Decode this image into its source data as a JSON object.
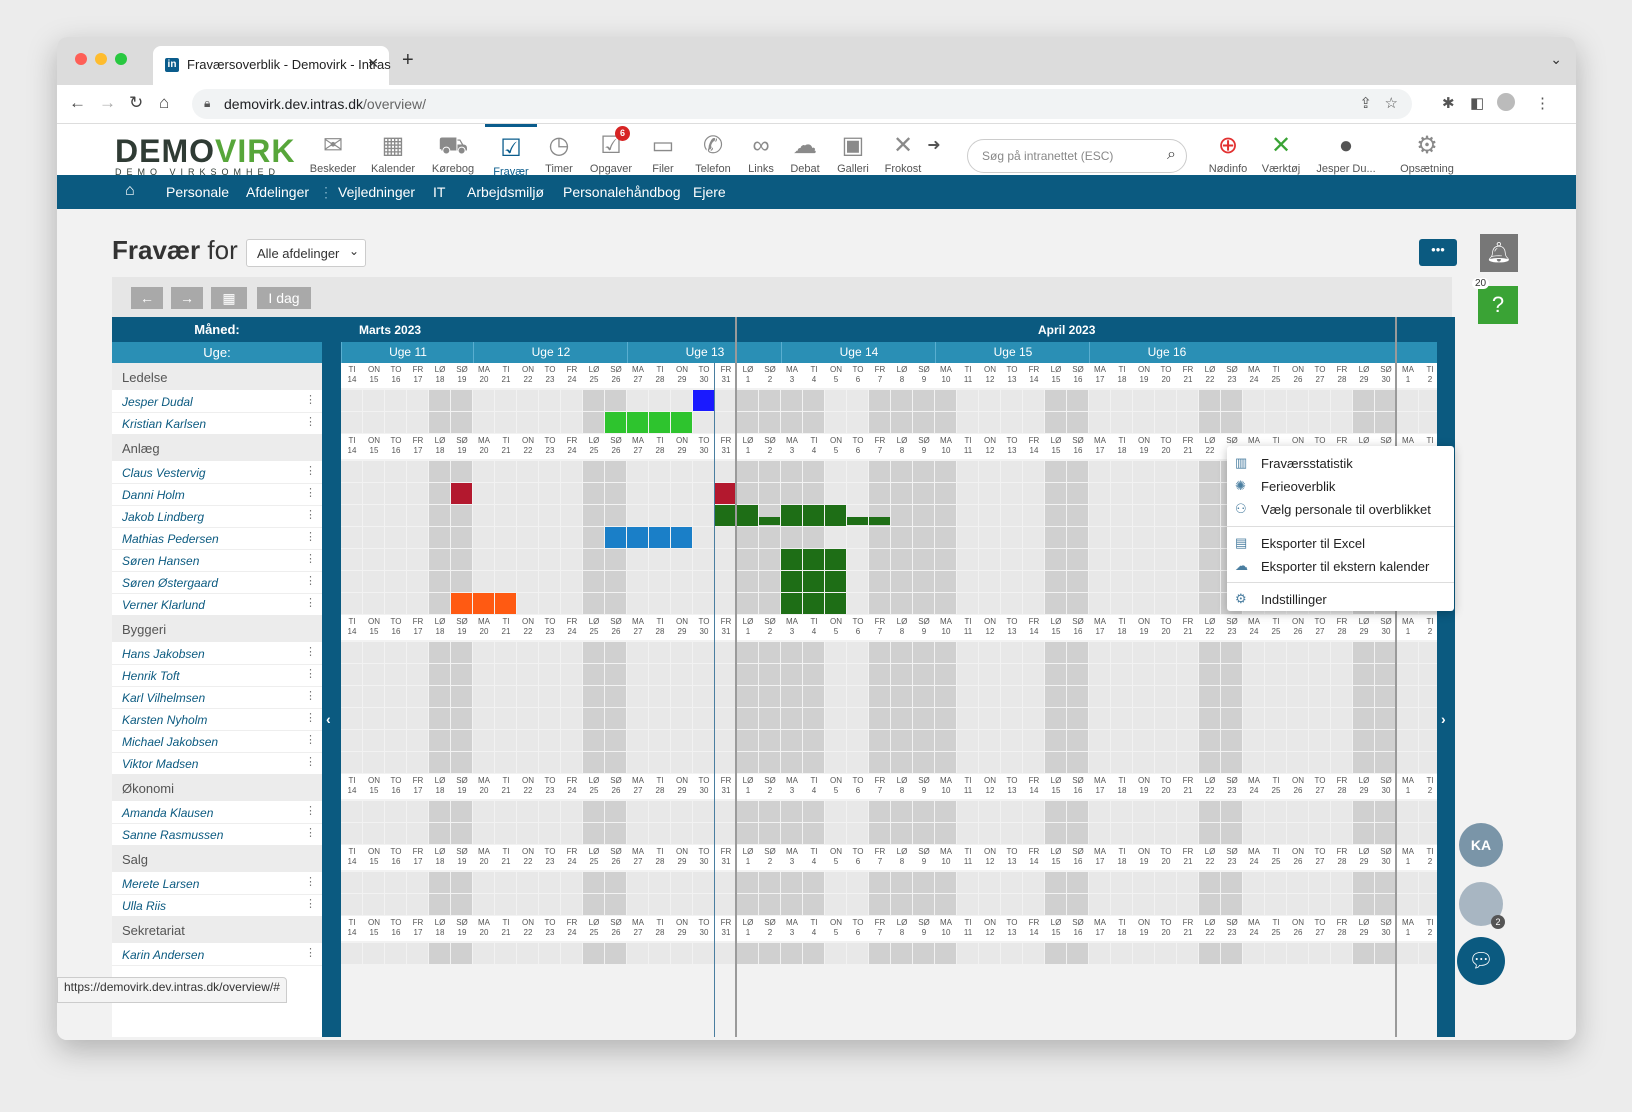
{
  "browser": {
    "tab_title": "Fraværsoverblik - Demovirk - Intras",
    "url_host": "demovirk.dev.intras.dk",
    "url_path": "/overview/",
    "status_url": "https://demovirk.dev.intras.dk/overview/#"
  },
  "logo": {
    "big_a": "DEMO",
    "big_b": "VIRK",
    "small": "DEMO VIRKSOMHED"
  },
  "apps": [
    {
      "label": "Beskeder",
      "icon": "✉"
    },
    {
      "label": "Kalender",
      "icon": "▦"
    },
    {
      "label": "Kørebog",
      "icon": "⛟"
    },
    {
      "label": "Fravær",
      "icon": "☑"
    },
    {
      "label": "Timer",
      "icon": "◷"
    },
    {
      "label": "Opgaver",
      "icon": "☑",
      "badge": "6"
    },
    {
      "label": "Filer",
      "icon": "▭"
    },
    {
      "label": "Telefon",
      "icon": "✆"
    },
    {
      "label": "Links",
      "icon": "∞"
    },
    {
      "label": "Debat",
      "icon": "☁"
    },
    {
      "label": "Galleri",
      "icon": "▣"
    },
    {
      "label": "Frokost",
      "icon": "✕"
    }
  ],
  "search": {
    "placeholder": "Søg på intranettet (ESC)"
  },
  "right_apps": [
    {
      "label": "Nødinfo",
      "icon": "⊕"
    },
    {
      "label": "Værktøj",
      "icon": "✕"
    },
    {
      "label": "Jesper Du...",
      "icon": "●"
    },
    {
      "label": "Opsætning",
      "icon": "⚙"
    }
  ],
  "nav": [
    "Personale",
    "Afdelinger",
    "Vejledninger",
    "IT",
    "Arbejdsmiljø",
    "Personalehåndbog",
    "Ejere"
  ],
  "page": {
    "title_bold": "Fravær",
    "title_rest": " for",
    "dept_select": "Alle afdelinger",
    "more": "•••",
    "help_badge": "20"
  },
  "toolbar": {
    "prev": "←",
    "next": "→",
    "cal": "▦",
    "today": "I dag"
  },
  "grid": {
    "month_label": "Måned:",
    "week_label": "Uge:",
    "months": [
      "Marts 2023",
      "April 2023"
    ],
    "weeks": [
      "Uge 11",
      "Uge 12",
      "Uge 13",
      "Uge 14",
      "Uge 15",
      "Uge 16"
    ],
    "day_abbr": [
      "TI",
      "ON",
      "TO",
      "FR",
      "LØ",
      "SØ",
      "MA",
      "TI",
      "ON",
      "TO",
      "FR",
      "LØ",
      "SØ",
      "MA",
      "TI",
      "ON",
      "TO",
      "FR",
      "LØ",
      "SØ",
      "MA",
      "TI",
      "ON",
      "TO",
      "FR",
      "LØ",
      "SØ",
      "MA",
      "TI",
      "ON",
      "TO",
      "FR",
      "LØ",
      "SØ",
      "MA",
      "TI",
      "ON",
      "TO",
      "FR",
      "LØ",
      "SØ",
      "MA",
      "TI",
      "ON",
      "TO",
      "FR",
      "LØ",
      "SØ",
      "MA",
      "TI"
    ],
    "day_num": [
      "14",
      "15",
      "16",
      "17",
      "18",
      "19",
      "20",
      "21",
      "22",
      "23",
      "24",
      "25",
      "26",
      "27",
      "28",
      "29",
      "30",
      "31",
      "1",
      "2",
      "3",
      "4",
      "5",
      "6",
      "7",
      "8",
      "9",
      "10",
      "11",
      "12",
      "13",
      "14",
      "15",
      "16",
      "17",
      "18",
      "19",
      "20",
      "21",
      "22",
      "23",
      "24",
      "25",
      "26",
      "27",
      "28",
      "29",
      "30",
      "1",
      "2"
    ]
  },
  "departments": [
    {
      "name": "Ledelse",
      "people": [
        "Jesper Dudal",
        "Kristian Karlsen"
      ]
    },
    {
      "name": "Anlæg",
      "people": [
        "Claus Vestervig",
        "Danni Holm",
        "Jakob Lindberg",
        "Mathias Pedersen",
        "Søren Hansen",
        "Søren Østergaard",
        "Verner Klarlund"
      ]
    },
    {
      "name": "Byggeri",
      "people": [
        "Hans Jakobsen",
        "Henrik Toft",
        "Karl Vilhelmsen",
        "Karsten Nyholm",
        "Michael Jakobsen",
        "Viktor Madsen"
      ]
    },
    {
      "name": "Økonomi",
      "people": [
        "Amanda Klausen",
        "Sanne Rasmussen"
      ]
    },
    {
      "name": "Salg",
      "people": [
        "Merete Larsen",
        "Ulla Riis"
      ]
    },
    {
      "name": "Sekretariat",
      "people": [
        "Karin Andersen"
      ]
    }
  ],
  "menu": [
    {
      "label": "Fraværsstatistik",
      "icon": "▥"
    },
    {
      "label": "Ferieoverblik",
      "icon": "✺"
    },
    {
      "label": "Vælg personale til overblikket",
      "icon": "⚇"
    },
    {
      "label": "Eksporter til Excel",
      "icon": "▤"
    },
    {
      "label": "Eksporter til ekstern kalender",
      "icon": "☁"
    },
    {
      "label": "Indstillinger",
      "icon": "⚙"
    }
  ],
  "colors": {
    "brand": "#0b5a80",
    "green": "#1e6e16",
    "lightgreen": "#2ec42e",
    "red": "#b3182e",
    "blue": "#1a7fc8",
    "orange": "#ff5a12",
    "navy": "#1a1aff"
  },
  "fab": {
    "initials": "KA",
    "count": "2"
  }
}
